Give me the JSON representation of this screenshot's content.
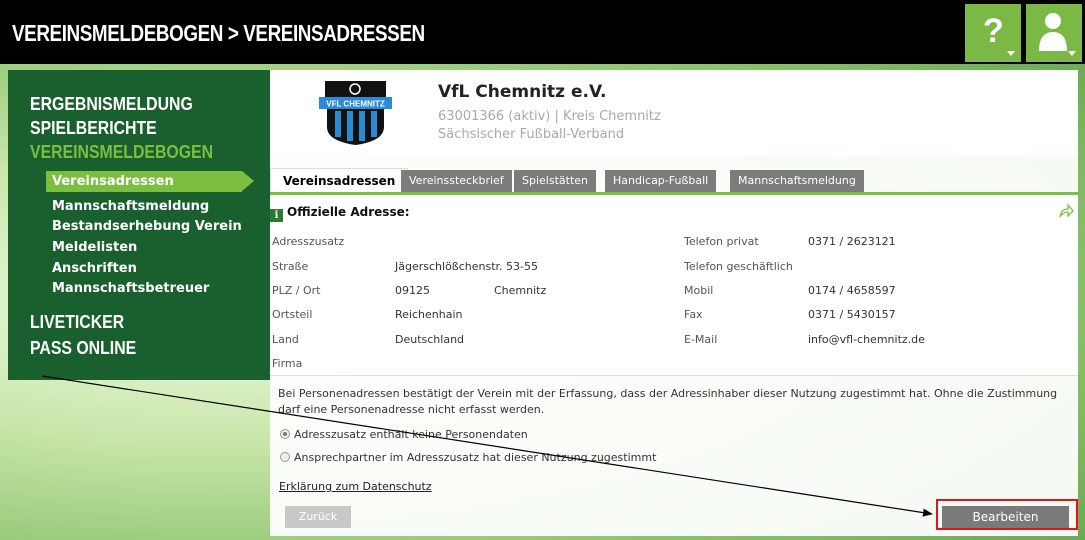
{
  "header": {
    "title": "VEREINSMELDEBOGEN > VEREINSADRESSEN",
    "help_label": "?",
    "help_icon": "question-mark-icon",
    "user_icon": "user-icon"
  },
  "colors": {
    "accent_green": "#7bbe41",
    "sidebar_green": "#1a5f2e",
    "highlight_red": "#e0161b"
  },
  "sidebar": {
    "main_items": [
      {
        "label": "ERGEBNISMELDUNG"
      },
      {
        "label": "SPIELBERICHTE"
      },
      {
        "label": "VEREINSMELDEBOGEN"
      }
    ],
    "sub_items": [
      {
        "label": "Vereinsadressen"
      },
      {
        "label": "Mannschaftsmeldung"
      },
      {
        "label": "Bestandserhebung Verein"
      },
      {
        "label": "Meldelisten"
      },
      {
        "label": "Anschriften"
      },
      {
        "label": "Mannschaftsbetreuer"
      }
    ],
    "bottom_items": [
      {
        "label": "LIVETICKER"
      },
      {
        "label": "PASS ONLINE"
      }
    ]
  },
  "club": {
    "name": "VfL Chemnitz e.V.",
    "id_line": "63001366 (aktiv) | Kreis Chemnitz",
    "federation": "Sächsischer Fußball-Verband",
    "logo_text": "VFL CHEMNITZ"
  },
  "tabs": [
    {
      "label": "Vereinsadressen"
    },
    {
      "label": "Vereinssteckbrief"
    },
    {
      "label": "Spielstätten"
    },
    {
      "label": "Handicap-Fußball"
    },
    {
      "label": "Mannschaftsmeldung"
    }
  ],
  "address": {
    "section_title": "Offizielle Adresse:",
    "info_icon_label": "i",
    "left": [
      {
        "label": "Adresszusatz",
        "value": "",
        "value2": ""
      },
      {
        "label": "Straße",
        "value": "Jägerschlößchenstr. 53-55",
        "value2": ""
      },
      {
        "label": "PLZ / Ort",
        "value": "09125",
        "value2": "Chemnitz"
      },
      {
        "label": "Ortsteil",
        "value": "Reichenhain",
        "value2": ""
      },
      {
        "label": "Land",
        "value": "Deutschland",
        "value2": ""
      },
      {
        "label": "Firma",
        "value": "",
        "value2": ""
      }
    ],
    "right": [
      {
        "label": "Telefon privat",
        "value": "0371 / 2623121"
      },
      {
        "label": "Telefon geschäftlich",
        "value": ""
      },
      {
        "label": "Mobil",
        "value": "0174 / 4658597"
      },
      {
        "label": "Fax",
        "value": "0371 / 5430157"
      },
      {
        "label": "E-Mail",
        "value": "info@vfl-chemnitz.de"
      }
    ]
  },
  "notice": {
    "text": "Bei Personenadressen bestätigt der Verein mit der Erfassung, dass der Adressinhaber dieser Nutzung zugestimmt hat. Ohne die Zustimmung darf eine Personenadresse nicht erfasst werden.",
    "options": [
      {
        "label": "Adresszusatz enthält keine Personendaten",
        "checked": true
      },
      {
        "label": "Ansprechpartner im Adresszusatz hat dieser Nutzung zugestimmt",
        "checked": false
      }
    ],
    "privacy_link": "Erklärung zum Datenschutz"
  },
  "buttons": {
    "back": "Zurück",
    "edit": "Bearbeiten"
  }
}
